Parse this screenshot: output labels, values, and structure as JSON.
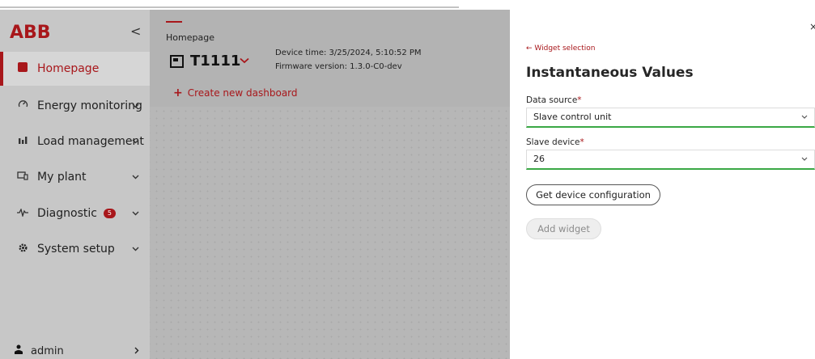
{
  "brand": {
    "logo_text": "ABB",
    "brand_color": "#a8171b"
  },
  "sidebar": {
    "collapse_glyph": "<",
    "items": [
      {
        "label": "Homepage",
        "icon": "home-icon",
        "active": true
      },
      {
        "label": "Energy monitoring",
        "icon": "energy-icon",
        "has_chevron": true
      },
      {
        "label": "Load management",
        "icon": "load-icon",
        "has_chevron": true
      },
      {
        "label": "My plant",
        "icon": "plant-icon",
        "has_chevron": true
      },
      {
        "label": "Diagnostic",
        "icon": "diagnostic-icon",
        "has_chevron": true,
        "badge": "5"
      },
      {
        "label": "System setup",
        "icon": "gear-icon",
        "has_chevron": true
      }
    ],
    "user": {
      "label": "admin",
      "icon": "user-icon"
    }
  },
  "main": {
    "breadcrumb": "Homepage",
    "device": {
      "name": "T1111",
      "device_time": "Device time: 3/25/2024, 5:10:52 PM",
      "firmware": "Firmware version: 1.3.0-C0-dev"
    },
    "create_dashboard": "Create new dashboard"
  },
  "panel": {
    "close_glyph": "×",
    "back_label": "Widget selection",
    "title": "Instantaneous Values",
    "data_source": {
      "label": "Data source",
      "required": "*",
      "value": "Slave control unit"
    },
    "slave_device": {
      "label": "Slave device",
      "required": "*",
      "value": "26"
    },
    "get_config_button": "Get device configuration",
    "add_widget_button": "Add widget",
    "valid_color": "#3aa845"
  }
}
